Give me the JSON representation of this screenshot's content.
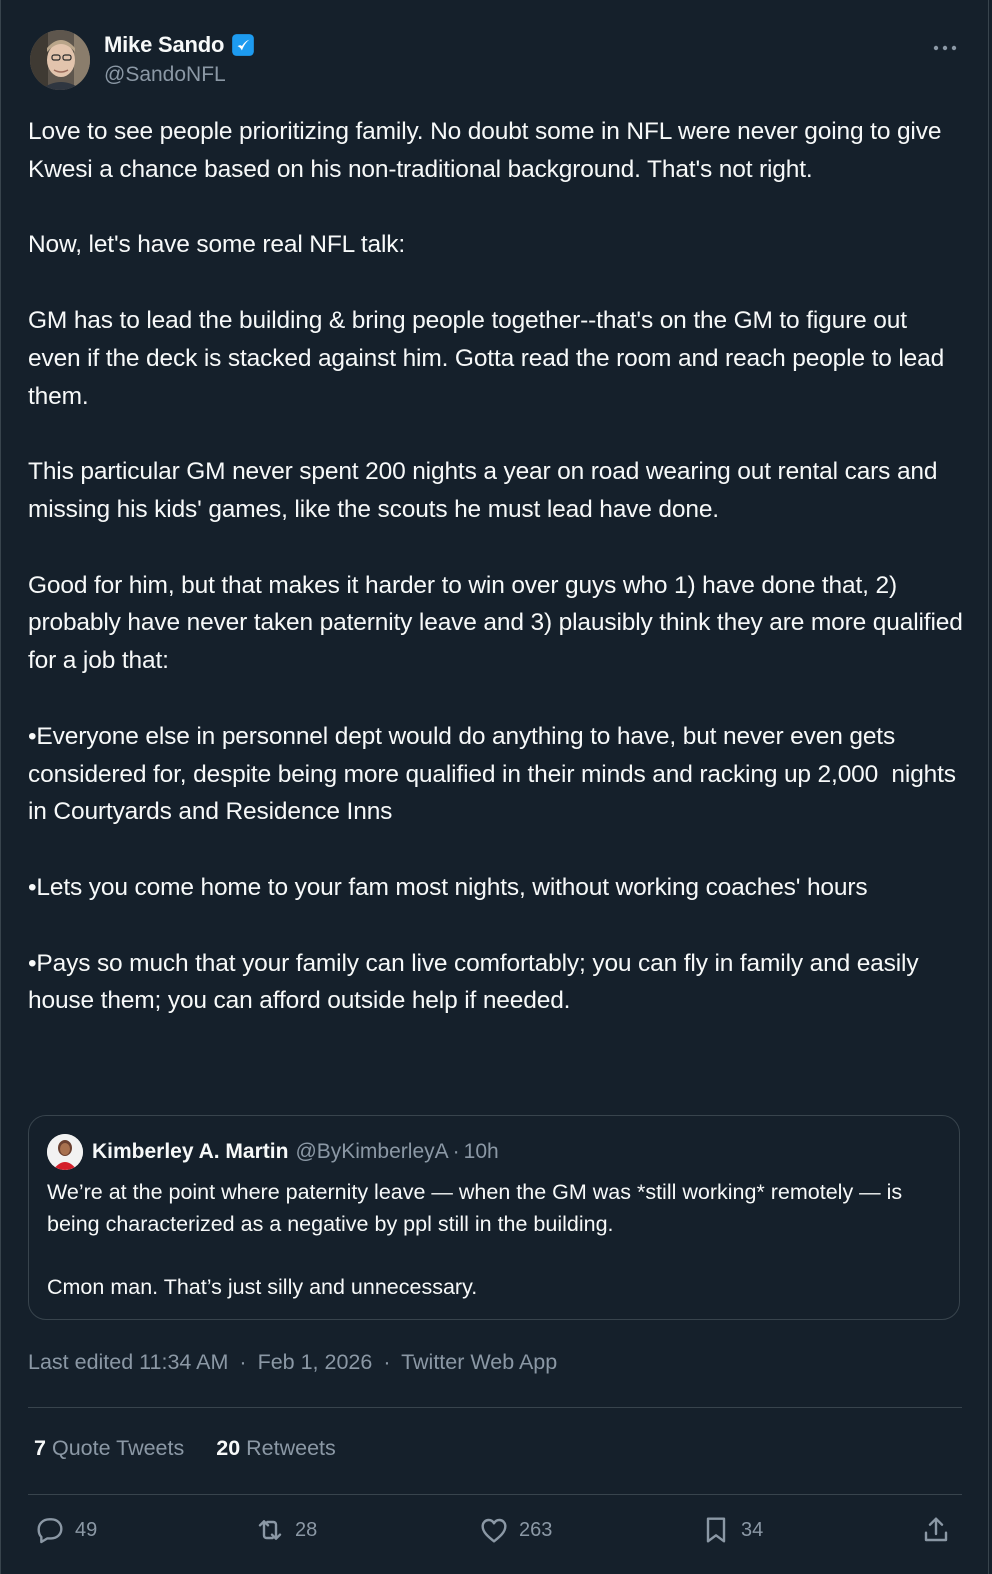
{
  "author": {
    "name": "Mike Sando",
    "handle": "@SandoNFL",
    "verified": true
  },
  "tweet": {
    "paragraphs": [
      "Love to see people prioritizing family. No doubt some in NFL were never going to give Kwesi a chance based on his non-traditional background. That's not right.",
      "Now, let's have some real NFL talk:",
      "GM has to lead the building & bring people together--that's on the GM to figure out even if the deck is stacked against him. Gotta read the room and reach people to lead them.",
      "This particular GM never spent 200 nights a year on road wearing out rental cars and missing his kids' games, like the scouts he must lead have done.",
      "Good for him, but that makes it harder to win over guys who 1) have done that, 2) probably have never taken paternity leave and 3) plausibly think they are more qualified for a job that:",
      "•Everyone else in personnel dept would do anything to have, but never even gets considered for, despite being more qualified in their minds and racking up 2,000  nights in Courtyards and Residence Inns",
      "•Lets you come home to your fam most nights, without working coaches' hours",
      "•Pays so much that your family can live comfortably; you can fly in family and easily house them; you can afford outside help if needed."
    ]
  },
  "quoted": {
    "name": "Kimberley A. Martin",
    "handle": "@ByKimberleyA",
    "separator": "·",
    "time": "10h",
    "line1": "We’re at the point where paternity leave — when the GM was *still working* remotely — is being characterized as a negative by ppl still in the building.",
    "line2": "Cmon man. That’s just silly and unnecessary."
  },
  "meta": {
    "edited": "Last edited 11:34 AM",
    "separator": "·",
    "date": "Feb 1, 2026",
    "source": "Twitter Web App"
  },
  "stats": {
    "quote_count": "7",
    "quote_label": "Quote Tweets",
    "retweet_count": "20",
    "retweet_label": "Retweets"
  },
  "actions": {
    "replies": "49",
    "retweets": "28",
    "likes": "263",
    "bookmarks": "34"
  },
  "colors": {
    "background": "#15202b",
    "text": "#f7f9f9",
    "secondary": "#8b98a5",
    "border": "#38444d",
    "verified": "#1d9bf0"
  }
}
